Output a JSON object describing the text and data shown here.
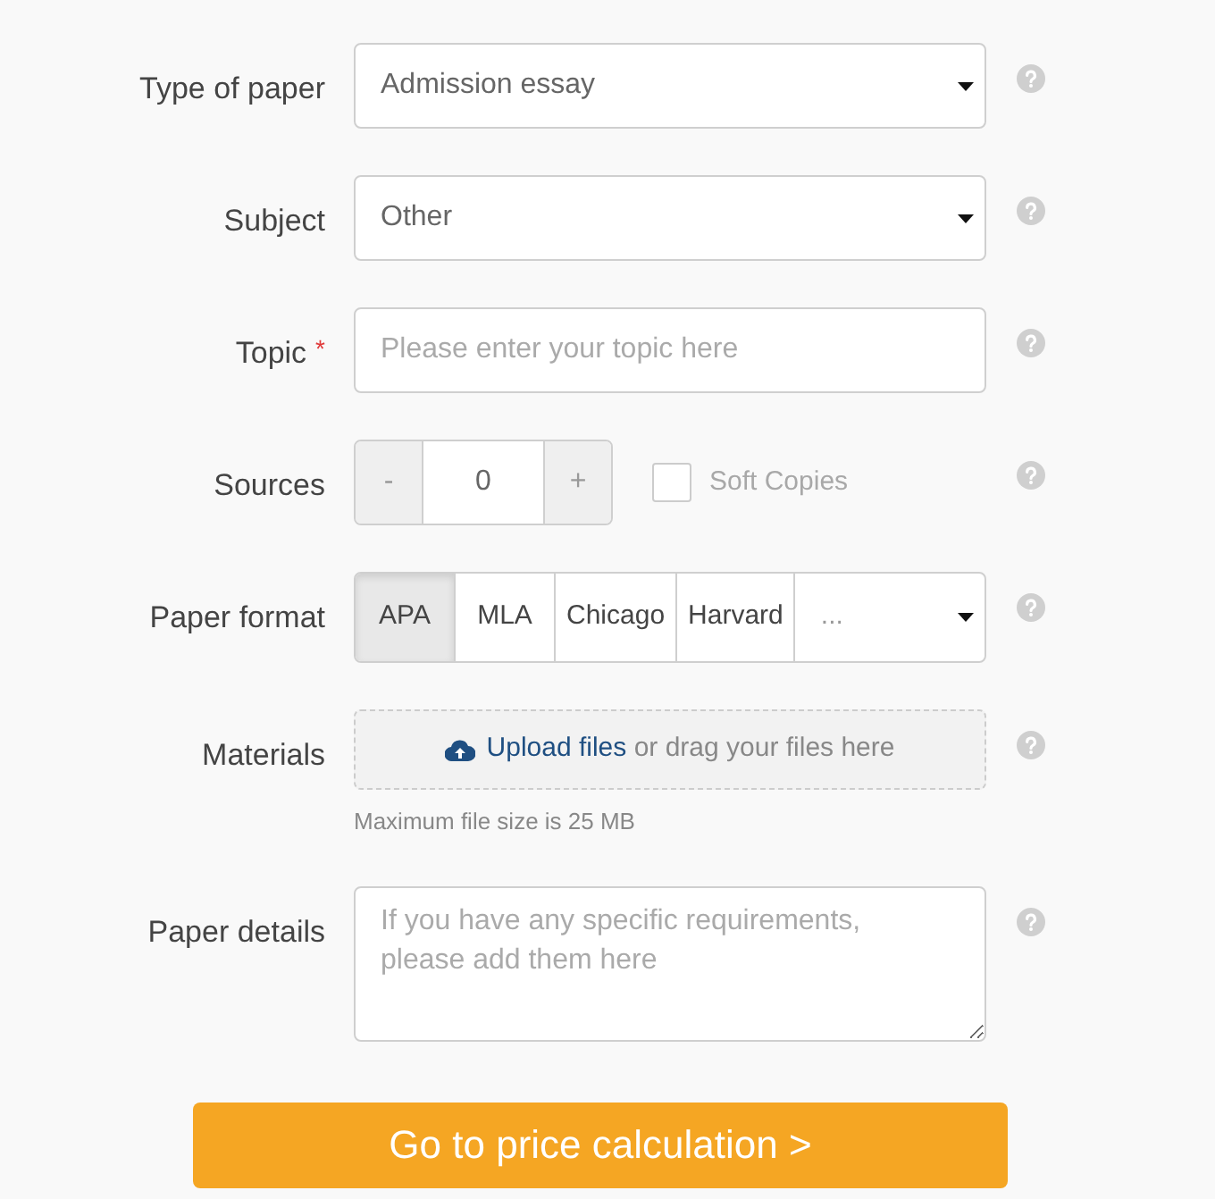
{
  "fields": [
    {
      "kind": "select",
      "label": "Type of paper",
      "value": "Admission essay"
    },
    {
      "kind": "select",
      "label": "Subject",
      "value": "Other"
    },
    {
      "kind": "text",
      "label": "Topic",
      "required_mark": "*",
      "placeholder": "Please enter your topic here"
    },
    {
      "kind": "counter",
      "label": "Sources",
      "minus": "-",
      "value": "0",
      "plus": "+",
      "checkbox": {
        "label": "Soft Copies",
        "checked": false,
        "disabled": true
      }
    },
    {
      "kind": "formats",
      "label": "Paper format",
      "options": [
        {
          "label": "APA",
          "selected": true
        },
        {
          "label": "MLA",
          "selected": false
        },
        {
          "label": "Chicago",
          "selected": false
        },
        {
          "label": "Harvard",
          "selected": false
        }
      ],
      "more": "..."
    },
    {
      "kind": "upload",
      "label": "Materials",
      "link": "Upload files",
      "text": "or drag your files here",
      "note": "Maximum file size is 25 MB"
    },
    {
      "kind": "textarea",
      "label": "Paper details",
      "placeholder": "If you have any specific requirements, please add them here"
    }
  ],
  "submit": "Go to price calculation >"
}
